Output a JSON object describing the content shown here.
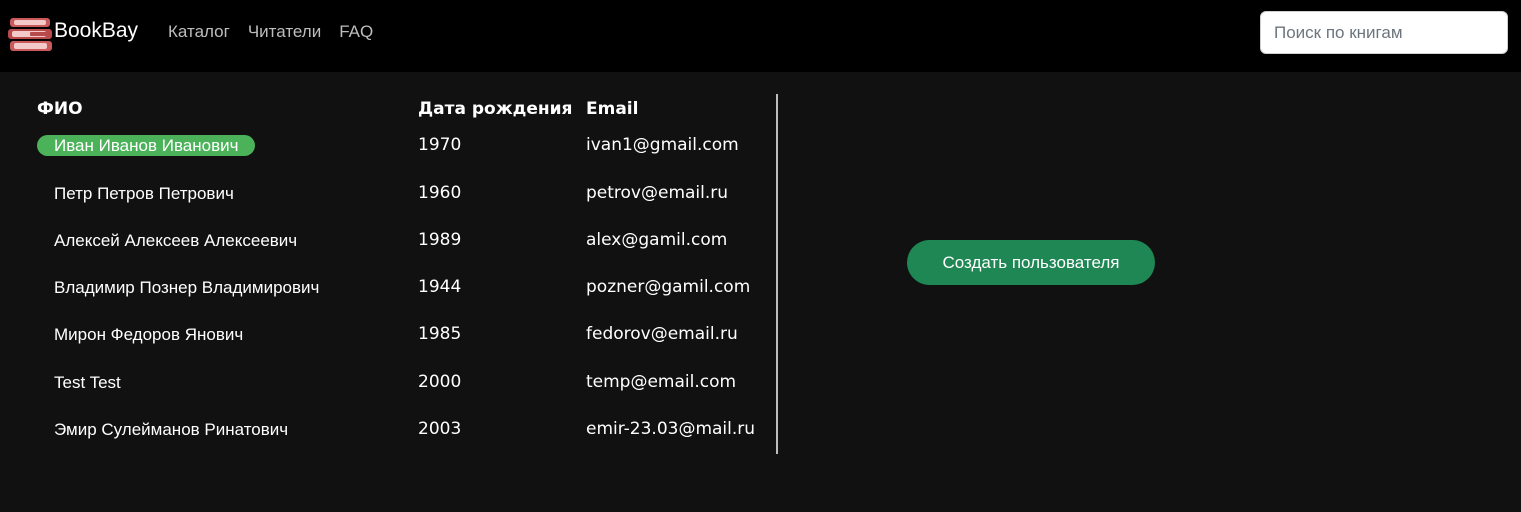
{
  "app": {
    "brand_name": "BookBay",
    "brand_logo_icon": "book-stack-icon",
    "accent_color": "#1e8754",
    "selected_row_color": "#4bb25a"
  },
  "nav": {
    "links": [
      {
        "label": "Каталог"
      },
      {
        "label": "Читатели"
      },
      {
        "label": "FAQ"
      }
    ]
  },
  "search": {
    "placeholder": "Поиск по книгам",
    "value": ""
  },
  "table": {
    "headers": {
      "name": "ФИО",
      "birth": "Дата рождения",
      "email": "Email"
    },
    "rows": [
      {
        "name": "Иван Иванов Иванович",
        "birth": "1970",
        "email": "ivan1@gmail.com",
        "selected": true
      },
      {
        "name": "Петр Петров Петрович",
        "birth": "1960",
        "email": "petrov@email.ru",
        "selected": false
      },
      {
        "name": "Алексей Алексеев Алексеевич",
        "birth": "1989",
        "email": "alex@gamil.com",
        "selected": false
      },
      {
        "name": "Владимир Познер Владимирович",
        "birth": "1944",
        "email": "pozner@gamil.com",
        "selected": false
      },
      {
        "name": "Мирон Федоров Янович",
        "birth": "1985",
        "email": "fedorov@email.ru",
        "selected": false
      },
      {
        "name": "Test Test",
        "birth": "2000",
        "email": "temp@email.com",
        "selected": false
      },
      {
        "name": "Эмир Сулейманов Ринатович",
        "birth": "2003",
        "email": "emir-23.03@mail.ru",
        "selected": false
      }
    ]
  },
  "actions": {
    "create_user_label": "Создать пользователя"
  }
}
